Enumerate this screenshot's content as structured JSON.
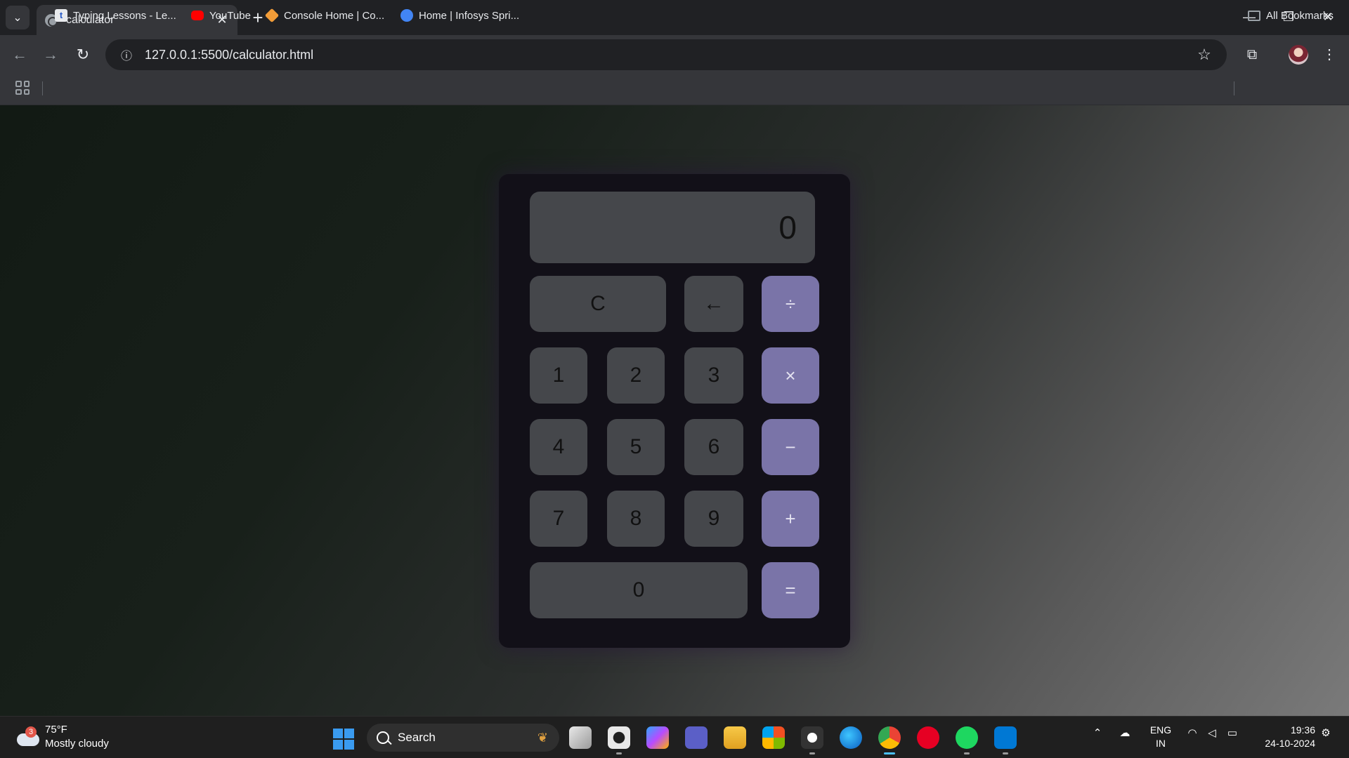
{
  "browser": {
    "tab_title": "calculator",
    "url": "127.0.0.1:5500/calculator.html",
    "bookmarks": [
      {
        "label": "Typing Lessons - Le...",
        "icon": "typing-icon",
        "color": "#e8eaed"
      },
      {
        "label": "YouTube",
        "icon": "youtube-icon",
        "color": "#ff0000"
      },
      {
        "label": "Console Home | Co...",
        "icon": "aws-cube-icon",
        "color": "#f29c38"
      },
      {
        "label": "Home | Infosys Spri...",
        "icon": "infosys-icon",
        "color": "#4285f4"
      }
    ],
    "all_bookmarks": "All Bookmarks"
  },
  "calculator": {
    "display": "0",
    "keys": {
      "clear": "C",
      "backspace": "←",
      "divide": "÷",
      "one": "1",
      "two": "2",
      "three": "3",
      "multiply": "×",
      "four": "4",
      "five": "5",
      "six": "6",
      "minus": "−",
      "seven": "7",
      "eight": "8",
      "nine": "9",
      "plus": "+",
      "zero": "0",
      "equals": "="
    },
    "colors": {
      "key": "#45474b",
      "operator": "#7a74a8",
      "body": "#121018"
    }
  },
  "taskbar": {
    "weather_badge": "3",
    "weather_temp": "75°F",
    "weather_desc": "Mostly cloudy",
    "search_label": "Search",
    "lang_top": "ENG",
    "lang_bottom": "IN",
    "time": "19:36",
    "date": "24-10-2024"
  }
}
